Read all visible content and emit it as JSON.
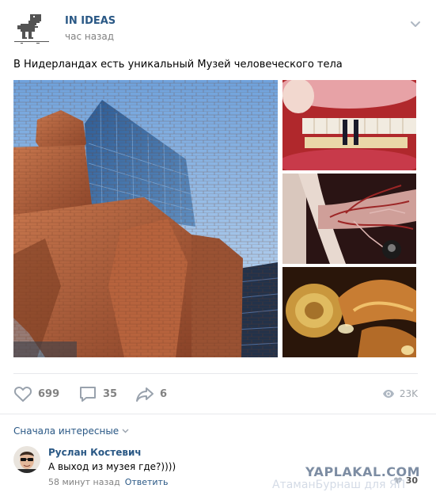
{
  "post": {
    "author": "IN IDEAS",
    "time": "час назад",
    "text": "В Нидерландах есть уникальный Музей человеческого тела"
  },
  "icons": {
    "avatar": "dino-icon",
    "menu": "chevron-down-icon",
    "like": "heart-icon",
    "comment": "comment-icon",
    "share": "share-icon",
    "views": "eye-icon",
    "comment_like": "heart-icon"
  },
  "photos": [
    "museum-building-photo",
    "mouth-teeth-photo",
    "lungs-bronchi-photo",
    "inner-ear-photo"
  ],
  "actions": {
    "likes": "699",
    "comments": "35",
    "shares": "6",
    "views": "23K"
  },
  "comments_sort": "Сначала интересные",
  "comment": {
    "author": "Руслан Костевич",
    "text": "А выход из музея где?))))",
    "time": "58 минут назад",
    "reply": "Ответить",
    "likes": "30"
  },
  "watermark": {
    "site": "YAPLAKAL.COM",
    "author": "АтаманБурнаш для ЯП"
  },
  "colors": {
    "link": "#2a5885",
    "muted": "#828282",
    "separator": "#e7e8ec"
  }
}
